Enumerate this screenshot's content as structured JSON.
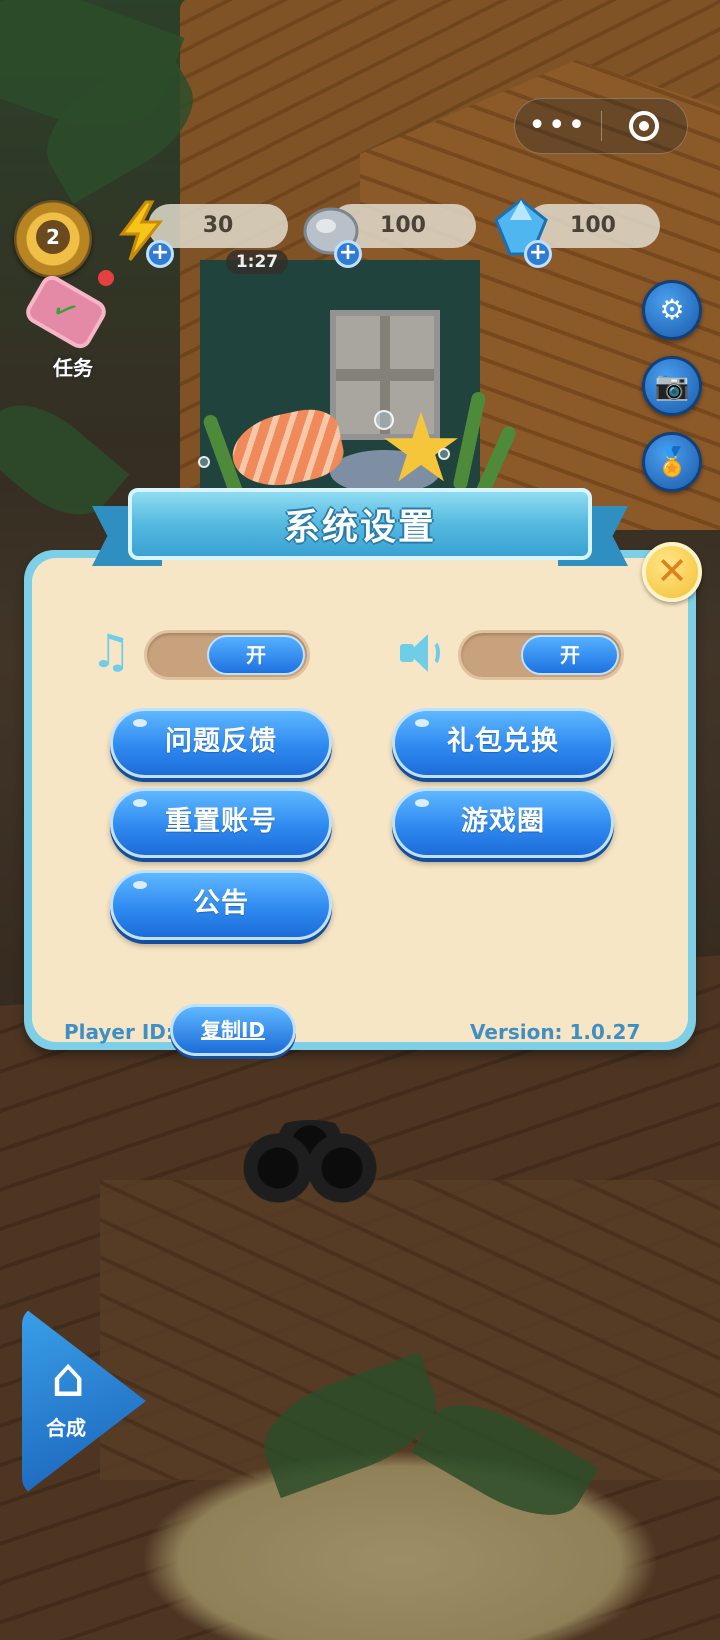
{
  "capsule": {
    "more_icon": "more-dots-icon",
    "target_icon": "target-icon"
  },
  "hud": {
    "level": "2",
    "energy": {
      "value": "30",
      "timer": "1:27",
      "icon": "lightning-icon"
    },
    "stone": {
      "value": "100",
      "icon": "stone-icon"
    },
    "gem": {
      "value": "100",
      "icon": "gem-icon"
    },
    "plus_symbol": "+"
  },
  "task": {
    "label": "任务"
  },
  "side_buttons": [
    "gear-icon",
    "camera-icon",
    "medal-icon"
  ],
  "settings": {
    "title": "系统设置",
    "music_toggle": "开",
    "sound_toggle": "开",
    "buttons": {
      "feedback": "问题反馈",
      "gift_redeem": "礼包兑换",
      "reset_account": "重置账号",
      "game_circle": "游戏圈",
      "announcement": "公告"
    },
    "player_id_label": "Player ID:",
    "copy_id": "复制ID",
    "version": "Version: 1.0.27"
  },
  "merge": {
    "label": "合成"
  },
  "colors": {
    "panel_border": "#7ccfe6",
    "panel_bg": "#f7e6c5",
    "button_blue": "#2f8af0",
    "close_yellow": "#f4bf35",
    "text_blue": "#3f8fc4"
  }
}
